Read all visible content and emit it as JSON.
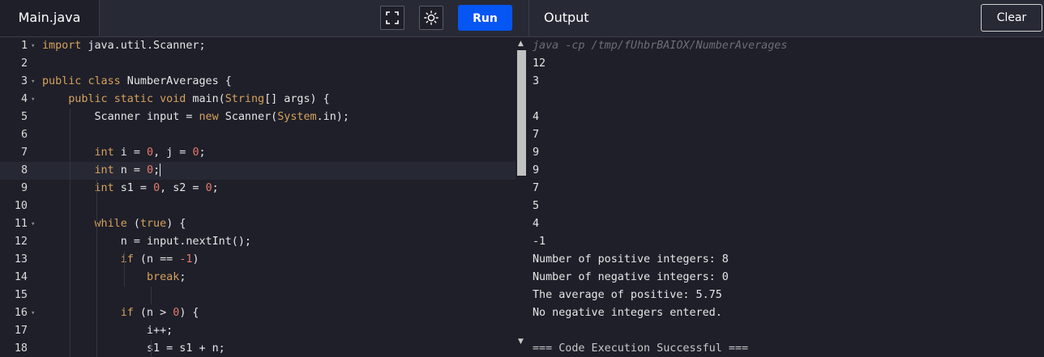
{
  "file_tab": {
    "label": "Main.java"
  },
  "toolbar": {
    "run_label": "Run"
  },
  "output_panel": {
    "title": "Output",
    "clear_label": "Clear",
    "lines": [
      {
        "text": "java -cp /tmp/fUhbrBAIOX/NumberAverages",
        "kind": "cmd"
      },
      {
        "text": "12",
        "kind": "out"
      },
      {
        "text": "3",
        "kind": "out"
      },
      {
        "text": "",
        "kind": "out"
      },
      {
        "text": "4",
        "kind": "out"
      },
      {
        "text": "7",
        "kind": "out"
      },
      {
        "text": "9",
        "kind": "out"
      },
      {
        "text": "9",
        "kind": "out"
      },
      {
        "text": "7",
        "kind": "out"
      },
      {
        "text": "5",
        "kind": "out"
      },
      {
        "text": "4",
        "kind": "out"
      },
      {
        "text": "-1",
        "kind": "out"
      },
      {
        "text": "Number of positive integers: 8",
        "kind": "out"
      },
      {
        "text": "Number of negative integers: 0",
        "kind": "out"
      },
      {
        "text": "The average of positive: 5.75",
        "kind": "out"
      },
      {
        "text": "No negative integers entered.",
        "kind": "out"
      },
      {
        "text": "",
        "kind": "out"
      },
      {
        "text": "=== Code Execution Successful ===",
        "kind": "success"
      }
    ]
  },
  "editor": {
    "active_line": 8,
    "lines": [
      {
        "number": "1",
        "fold": true,
        "tokens": [
          [
            "kw",
            "import"
          ],
          [
            "t",
            " java.util.Scanner;"
          ]
        ]
      },
      {
        "number": "2",
        "fold": false,
        "tokens": []
      },
      {
        "number": "3",
        "fold": true,
        "tokens": [
          [
            "kw",
            "public"
          ],
          [
            "t",
            " "
          ],
          [
            "kw",
            "class"
          ],
          [
            "t",
            " NumberAverages {"
          ]
        ]
      },
      {
        "number": "4",
        "fold": true,
        "tokens": [
          [
            "t",
            "    "
          ],
          [
            "kw",
            "public"
          ],
          [
            "t",
            " "
          ],
          [
            "kw",
            "static"
          ],
          [
            "t",
            " "
          ],
          [
            "kw",
            "void"
          ],
          [
            "t",
            " main("
          ],
          [
            "cls",
            "String"
          ],
          [
            "t",
            "[] args) {"
          ]
        ]
      },
      {
        "number": "5",
        "fold": false,
        "tokens": [
          [
            "t",
            "        Scanner input = "
          ],
          [
            "kw",
            "new"
          ],
          [
            "t",
            " Scanner("
          ],
          [
            "cls",
            "System"
          ],
          [
            "t",
            ".in);"
          ]
        ]
      },
      {
        "number": "6",
        "fold": false,
        "tokens": []
      },
      {
        "number": "7",
        "fold": false,
        "tokens": [
          [
            "t",
            "        "
          ],
          [
            "kw",
            "int"
          ],
          [
            "t",
            " i = "
          ],
          [
            "num",
            "0"
          ],
          [
            "t",
            ", j = "
          ],
          [
            "num",
            "0"
          ],
          [
            "t",
            ";"
          ]
        ]
      },
      {
        "number": "8",
        "fold": false,
        "tokens": [
          [
            "t",
            "        "
          ],
          [
            "kw",
            "int"
          ],
          [
            "t",
            " n = "
          ],
          [
            "num",
            "0"
          ],
          [
            "t",
            ";"
          ]
        ]
      },
      {
        "number": "9",
        "fold": false,
        "tokens": [
          [
            "t",
            "        "
          ],
          [
            "kw",
            "int"
          ],
          [
            "t",
            " s1 = "
          ],
          [
            "num",
            "0"
          ],
          [
            "t",
            ", s2 = "
          ],
          [
            "num",
            "0"
          ],
          [
            "t",
            ";"
          ]
        ]
      },
      {
        "number": "10",
        "fold": false,
        "tokens": []
      },
      {
        "number": "11",
        "fold": true,
        "tokens": [
          [
            "t",
            "        "
          ],
          [
            "kw",
            "while"
          ],
          [
            "t",
            " ("
          ],
          [
            "kw",
            "true"
          ],
          [
            "t",
            ") {"
          ]
        ]
      },
      {
        "number": "12",
        "fold": false,
        "tokens": [
          [
            "t",
            "            n = input.nextInt();"
          ]
        ]
      },
      {
        "number": "13",
        "fold": false,
        "tokens": [
          [
            "t",
            "            "
          ],
          [
            "kw",
            "if"
          ],
          [
            "t",
            " (n == "
          ],
          [
            "num",
            "-1"
          ],
          [
            "t",
            ")"
          ]
        ]
      },
      {
        "number": "14",
        "fold": false,
        "tokens": [
          [
            "t",
            "                "
          ],
          [
            "kw",
            "break"
          ],
          [
            "t",
            ";"
          ]
        ]
      },
      {
        "number": "15",
        "fold": false,
        "tokens": []
      },
      {
        "number": "16",
        "fold": true,
        "tokens": [
          [
            "t",
            "            "
          ],
          [
            "kw",
            "if"
          ],
          [
            "t",
            " (n > "
          ],
          [
            "num",
            "0"
          ],
          [
            "t",
            ") {"
          ]
        ]
      },
      {
        "number": "17",
        "fold": false,
        "tokens": [
          [
            "t",
            "                i++;"
          ]
        ]
      },
      {
        "number": "18",
        "fold": false,
        "tokens": [
          [
            "t",
            "                s1 = s1 + n;"
          ]
        ]
      }
    ]
  }
}
